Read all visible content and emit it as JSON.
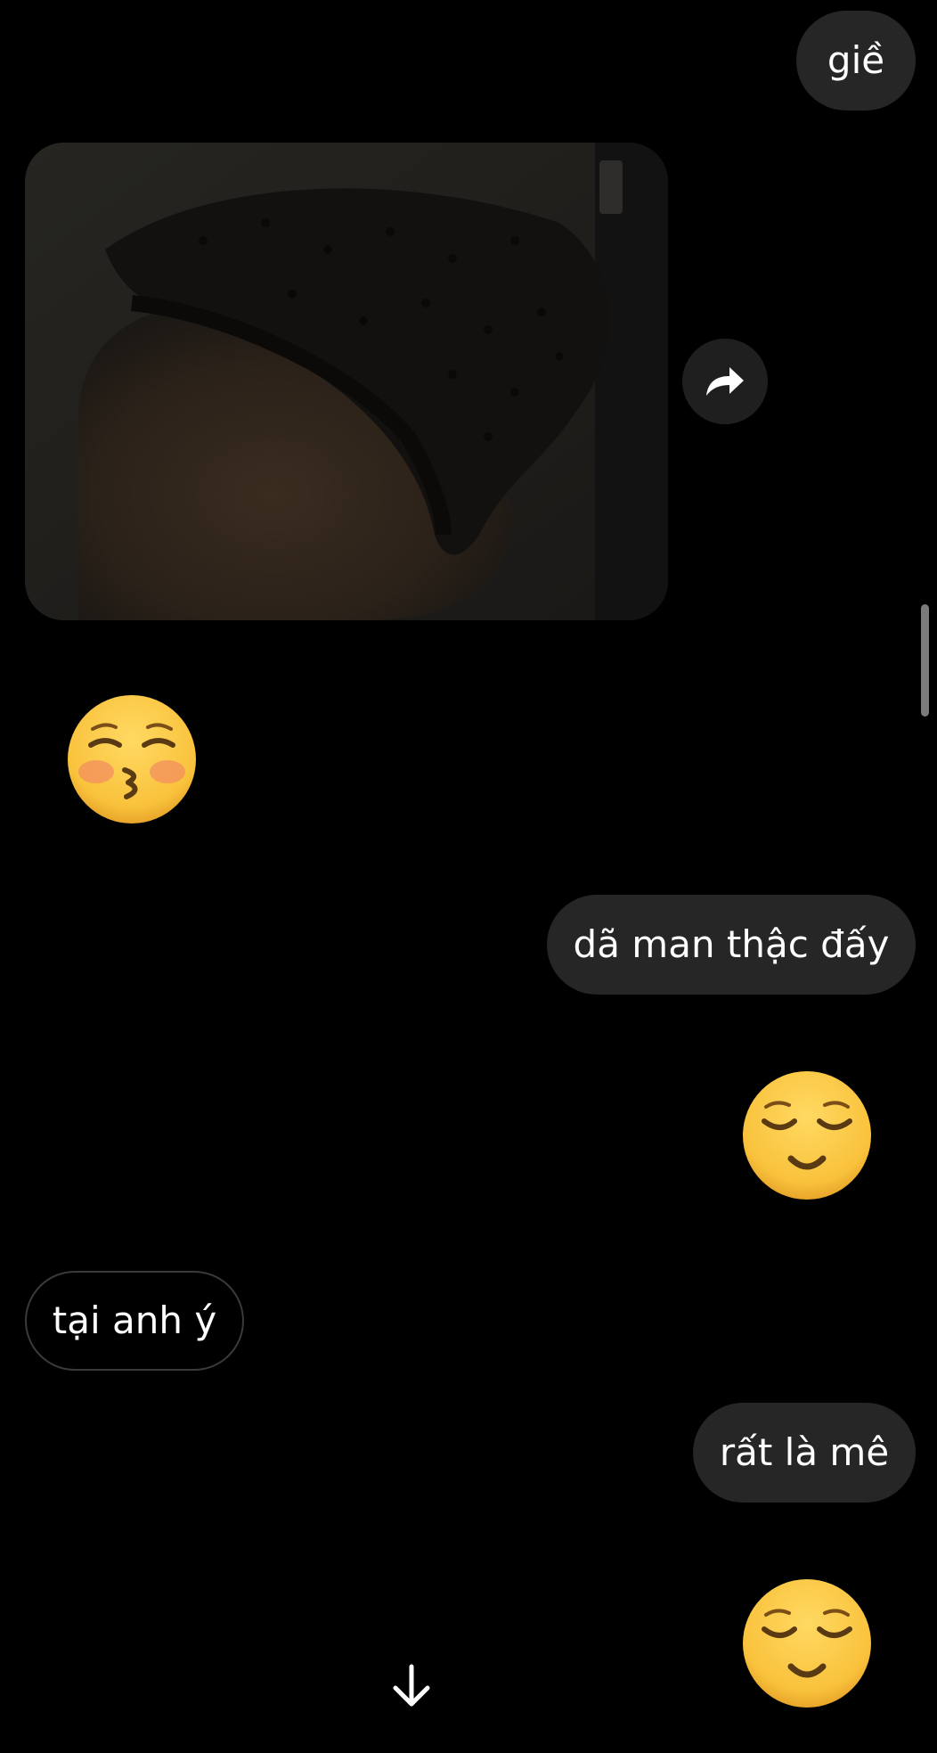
{
  "messages": {
    "m1": {
      "text": "giề",
      "direction": "sent"
    },
    "m2": {
      "kind": "photo",
      "direction": "received"
    },
    "m3": {
      "kind": "emoji",
      "emoji": "kissing-face-with-closed-eyes",
      "direction": "received"
    },
    "m4": {
      "text": "dã man thậc đấy",
      "direction": "sent"
    },
    "m5": {
      "kind": "emoji",
      "emoji": "relieved-face",
      "direction": "sent"
    },
    "m6": {
      "text": "tại anh ý",
      "direction": "received"
    },
    "m7": {
      "text": "rất là mê",
      "direction": "sent"
    },
    "m8": {
      "kind": "emoji",
      "emoji": "relieved-face",
      "direction": "sent"
    }
  },
  "controls": {
    "share_icon": "share-arrow-icon",
    "scroll_down_icon": "arrow-down-icon"
  },
  "colors": {
    "background": "#000000",
    "sent_bubble": "#262626",
    "received_bubble_border": "#3a3a3a",
    "text": "#ffffff",
    "emoji_face": "#f9c23c"
  }
}
